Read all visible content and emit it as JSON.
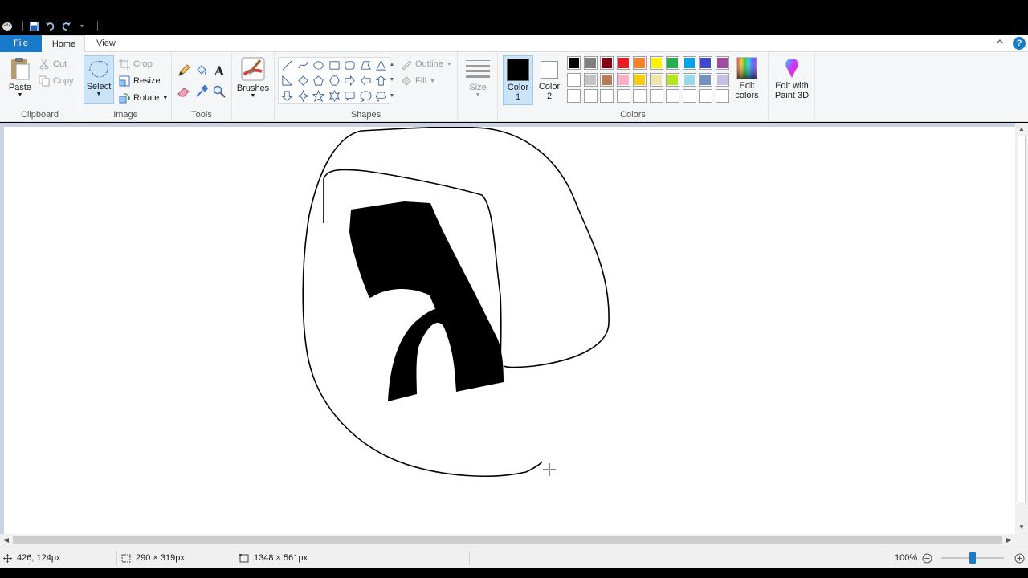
{
  "tabs": {
    "file": "File",
    "home": "Home",
    "view": "View"
  },
  "help_label": "?",
  "clipboard": {
    "paste": "Paste",
    "cut": "Cut",
    "copy": "Copy",
    "label": "Clipboard"
  },
  "image": {
    "select": "Select",
    "crop": "Crop",
    "resize": "Resize",
    "rotate": "Rotate",
    "label": "Image"
  },
  "tools": {
    "label": "Tools",
    "items": [
      "pencil-icon",
      "fill-bucket-icon",
      "text-icon",
      "eraser-icon",
      "color-picker-icon",
      "magnifier-icon"
    ]
  },
  "brushes": {
    "label": "Brushes"
  },
  "shapes": {
    "label": "Shapes",
    "outline": "Outline",
    "fill": "Fill",
    "items": [
      "line",
      "curve",
      "oval",
      "rectangle",
      "rounded-rectangle",
      "polygon",
      "triangle",
      "right-triangle",
      "diamond",
      "pentagon",
      "hexagon",
      "right-arrow",
      "left-arrow",
      "up-arrow",
      "down-arrow",
      "four-point-star",
      "five-point-star",
      "six-point-star",
      "rounded-callout",
      "oval-callout",
      "cloud-callout"
    ]
  },
  "size": {
    "label": "Size"
  },
  "colors": {
    "label": "Colors",
    "color1": "Color",
    "color1_num": "1",
    "color2": "Color",
    "color2_num": "2",
    "color1_value": "#000000",
    "color2_value": "#ffffff",
    "edit_colors_line1": "Edit",
    "edit_colors_line2": "colors",
    "palette_row1": [
      "#000000",
      "#7f7f7f",
      "#880015",
      "#ed1c24",
      "#ff7f27",
      "#fff200",
      "#22b14c",
      "#00a2e8",
      "#3f48cc",
      "#a349a4"
    ],
    "palette_row2": [
      "#ffffff",
      "#c3c3c3",
      "#b97a57",
      "#ffaec9",
      "#ffc90e",
      "#efe4b0",
      "#b5e61d",
      "#99d9ea",
      "#7092be",
      "#c8bfe7"
    ],
    "palette_row3": [
      "#ffffff",
      "#ffffff",
      "#ffffff",
      "#ffffff",
      "#ffffff",
      "#ffffff",
      "#ffffff",
      "#ffffff",
      "#ffffff",
      "#ffffff"
    ]
  },
  "paint3d": {
    "line1": "Edit with",
    "line2": "Paint 3D"
  },
  "status": {
    "cursor_pos": "426, 124px",
    "selection_size": "290 × 319px",
    "image_size": "1348 × 561px",
    "zoom": "100%",
    "zoom_level": 1.0
  }
}
